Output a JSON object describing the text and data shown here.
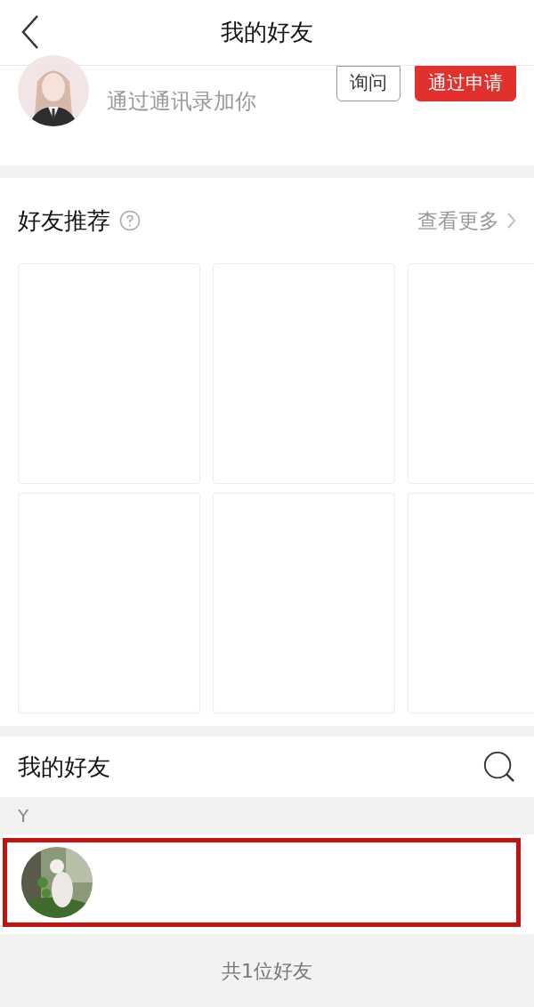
{
  "header": {
    "title": "我的好友"
  },
  "request": {
    "subtitle": "通过通讯录加你",
    "buttons": [
      {
        "label": "询问",
        "kind": "outline"
      },
      {
        "label": "通过申请",
        "kind": "primary"
      }
    ]
  },
  "recommend": {
    "title": "好友推荐",
    "more": "查看更多",
    "cards": [
      {
        "kind": "blank"
      },
      {
        "kind": "blank"
      },
      {
        "kind": "blank"
      },
      {
        "kind": "blank"
      },
      {
        "kind": "blank"
      },
      {
        "kind": "blank"
      }
    ]
  },
  "friends": {
    "title": "我的好友",
    "groups": [
      {
        "letter": "Y",
        "items": [
          {
            "highlighted": true
          }
        ]
      }
    ]
  },
  "footer": {
    "count": "共1位好友"
  }
}
